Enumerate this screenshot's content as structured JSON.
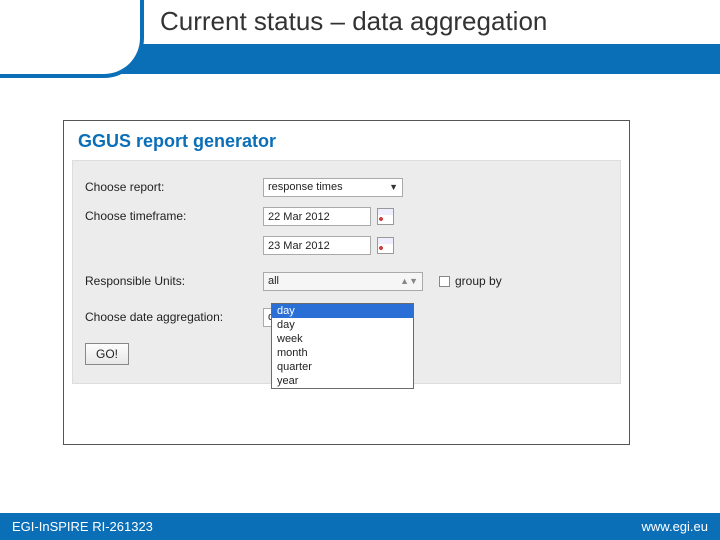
{
  "header": {
    "title": "Current status – data aggregation"
  },
  "panel": {
    "title": "GGUS report generator",
    "labels": {
      "report": "Choose report:",
      "timeframe": "Choose timeframe:",
      "units": "Responsible Units:",
      "aggregation": "Choose date aggregation:",
      "groupby": "group by"
    },
    "values": {
      "report": "response times",
      "date_from": "22 Mar 2012",
      "date_to": "23 Mar 2012",
      "units": "all",
      "aggregation": "day"
    },
    "aggregation_options": [
      "day",
      "day",
      "week",
      "month",
      "quarter",
      "year"
    ],
    "go": "GO!"
  },
  "footer": {
    "left": "EGI-InSPIRE RI-261323",
    "right": "www.egi.eu"
  }
}
